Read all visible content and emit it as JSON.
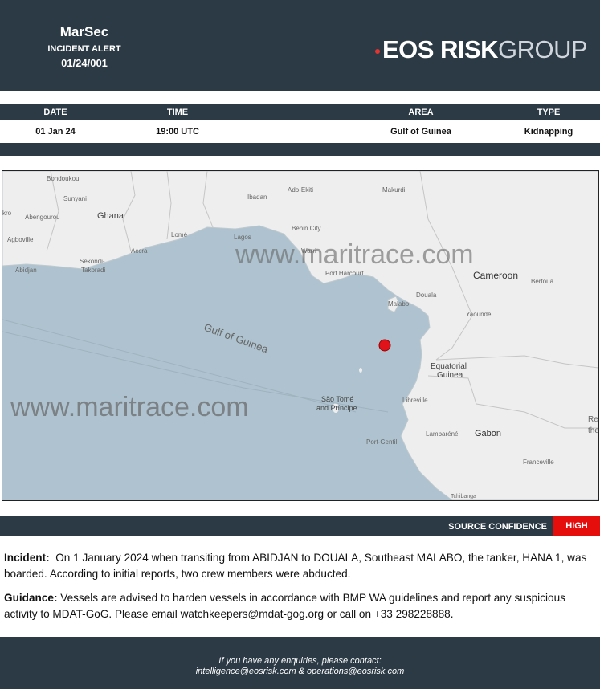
{
  "header": {
    "brand": "MarSec",
    "subtitle": "INCIDENT ALERT",
    "ref": "01/24/001",
    "logo": {
      "eos": "EOS",
      "risk": "RISK",
      "group": "GROUP",
      "dot_color": "#e3342f"
    }
  },
  "info": {
    "headers": [
      "DATE",
      "TIME",
      "AREA",
      "TYPE"
    ],
    "values": [
      "01 Jan 24",
      "19:00 UTC",
      "Gulf of Guinea",
      "Kidnapping"
    ]
  },
  "map": {
    "watermark": "www.maritrace.com",
    "sea_label": "Gulf of Guinea",
    "marker_color": "#e0121a",
    "labels": {
      "bondoukou": "Bondoukou",
      "sunyani": "Sunyani",
      "kro": "kro",
      "abengourou": "Abengourou",
      "ghana": "Ghana",
      "agboville": "Agboville",
      "sekondi": "Sekondi-",
      "takoradi": "Takoradi",
      "abidjan": "Abidjan",
      "accra": "Accra",
      "lome": "Lomé",
      "lagos": "Lagos",
      "ibadan": "Ibadan",
      "ado_ekiti": "Ado-Ekiti",
      "benin_city": "Benin City",
      "warri": "Warri",
      "port_harcourt": "Port Harcourt",
      "makurdi": "Makurdi",
      "malabo": "Malabo",
      "douala": "Douala",
      "cameroon": "Cameroon",
      "bertoua": "Bertoua",
      "yaounde": "Yaoundé",
      "equatorial": "Equatorial",
      "guinea": "Guinea",
      "sao_tome": "São Tomé",
      "and_principe": "and Príncipe",
      "libreville": "Libreville",
      "gabon": "Gabon",
      "lambarene": "Lambaréné",
      "port_gentil": "Port-Gentil",
      "franceville": "Franceville",
      "tchibanga": "Tchibanga",
      "re": "Re",
      "the": "the"
    }
  },
  "confidence": {
    "label": "SOURCE CONFIDENCE",
    "value": "HIGH",
    "color": "#e60d0d"
  },
  "incident": {
    "label": "Incident:",
    "text": "On 1 January 2024 when transiting from ABIDJAN to DOUALA, Southeast MALABO, the tanker, HANA 1, was boarded. According to initial reports, two crew members were abducted."
  },
  "guidance": {
    "label": "Guidance:",
    "text": "Vessels are advised to harden vessels in accordance with BMP WA guidelines and report any suspicious activity to MDAT-GoG. Please email watchkeepers@mdat-gog.org or call on +33 298228888."
  },
  "footer": {
    "line1": "If you have any enquiries, please contact:",
    "line2": "intelligence@eosrisk.com & operations@eosrisk.com"
  }
}
